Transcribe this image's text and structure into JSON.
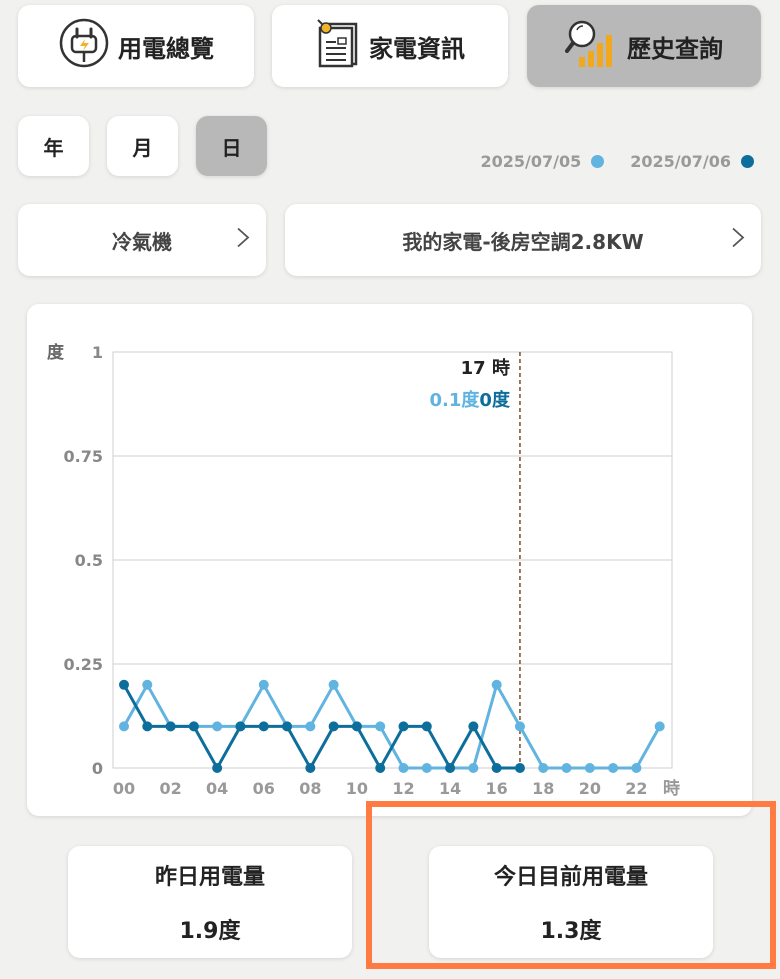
{
  "nav": {
    "overview": "用電總覽",
    "appliance_info": "家電資訊",
    "history": "歷史查詢"
  },
  "period": {
    "year": "年",
    "month": "月",
    "day": "日",
    "selected": "日"
  },
  "legend": {
    "date1": "2025/07/05",
    "date2": "2025/07/06"
  },
  "selectors": {
    "category": "冷氣機",
    "appliance": "我的家電-後房空調2.8KW"
  },
  "colors": {
    "series1": "#61b3e0",
    "series2": "#0d6e9c",
    "accent_border": "#ff7b42",
    "active_button": "#b8b8b8"
  },
  "chart_data": {
    "type": "line",
    "ylabel": "度",
    "xlabel": "時",
    "ylim": [
      0,
      1
    ],
    "yticks": [
      "0",
      "0.25",
      "0.5",
      "0.75",
      "1"
    ],
    "xticks": [
      "00",
      "02",
      "04",
      "06",
      "08",
      "10",
      "12",
      "14",
      "16",
      "18",
      "20",
      "22"
    ],
    "grid": true,
    "x": [
      0,
      1,
      2,
      3,
      4,
      5,
      6,
      7,
      8,
      9,
      10,
      11,
      12,
      13,
      14,
      15,
      16,
      17,
      18,
      19,
      20,
      21,
      22,
      23
    ],
    "series": [
      {
        "name": "2025/07/05",
        "color": "#61b3e0",
        "values": [
          0.1,
          0.2,
          0.1,
          0.1,
          0.1,
          0.1,
          0.2,
          0.1,
          0.1,
          0.2,
          0.1,
          0.1,
          0,
          0,
          0,
          0,
          0.2,
          0.1,
          0,
          0,
          0,
          0,
          0,
          0.1
        ]
      },
      {
        "name": "2025/07/06",
        "color": "#0d6e9c",
        "values": [
          0.2,
          0.1,
          0.1,
          0.1,
          0,
          0.1,
          0.1,
          0.1,
          0,
          0.1,
          0.1,
          0,
          0.1,
          0.1,
          0,
          0.1,
          0,
          0
        ]
      }
    ],
    "cursor": {
      "hour": 17,
      "hour_label": "17 時",
      "value1_label": "0.1度",
      "value2_label": "0度"
    }
  },
  "summary": {
    "yesterday_label": "昨日用電量",
    "yesterday_value": "1.9度",
    "today_label": "今日目前用電量",
    "today_value": "1.3度"
  }
}
